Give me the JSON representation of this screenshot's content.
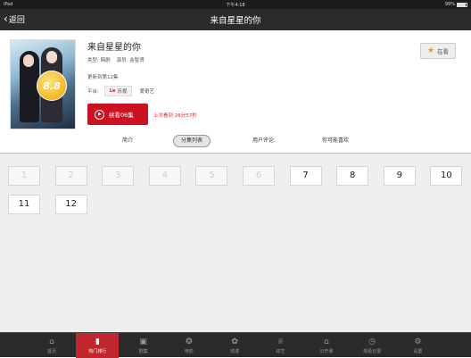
{
  "status_bar": {
    "device": "iPad",
    "time": "下午4:18",
    "battery": "99%"
  },
  "nav": {
    "back_label": "返回",
    "title": "来自星星的你"
  },
  "show": {
    "title": "来自星星的你",
    "genre_label": "类型:",
    "genre": "韩剧",
    "cast_label": "演员:",
    "cast": "金智贤",
    "update_status": "更新到第12集",
    "platform_label": "平台:",
    "platforms": [
      "乐视",
      "爱奇艺"
    ],
    "platform_letv_mark": "Le",
    "score": "8.8",
    "play_label": "续看06集",
    "last_watched": "上次看到 26分57秒",
    "watch_label": "在看"
  },
  "tabs": [
    "简介",
    "分集列表",
    "用户评论",
    "你可能喜欢"
  ],
  "active_tab": 1,
  "episodes": [
    {
      "num": "1",
      "available": false
    },
    {
      "num": "2",
      "available": false
    },
    {
      "num": "3",
      "available": false
    },
    {
      "num": "4",
      "available": false
    },
    {
      "num": "5",
      "available": false
    },
    {
      "num": "6",
      "available": false
    },
    {
      "num": "7",
      "available": true
    },
    {
      "num": "8",
      "available": true
    },
    {
      "num": "9",
      "available": true
    },
    {
      "num": "10",
      "available": true
    },
    {
      "num": "11",
      "available": true
    },
    {
      "num": "12",
      "available": true
    }
  ],
  "tabbar": [
    {
      "label": "首页",
      "icon": "home-icon",
      "glyph": "⌂"
    },
    {
      "label": "热门排行",
      "icon": "ranking-icon",
      "glyph": "▮",
      "active": true
    },
    {
      "label": "剧集",
      "icon": "tv-series-icon",
      "glyph": "▣"
    },
    {
      "label": "电影",
      "icon": "film-reel-icon",
      "glyph": "❂"
    },
    {
      "label": "动漫",
      "icon": "anime-icon",
      "glyph": "✿"
    },
    {
      "label": "综艺",
      "icon": "variety-icon",
      "glyph": "♕"
    },
    {
      "label": "公开课",
      "icon": "open-course-icon",
      "glyph": "⌂"
    },
    {
      "label": "观看记录",
      "icon": "history-clock-icon",
      "glyph": "◷"
    },
    {
      "label": "设置",
      "icon": "settings-gear-icon",
      "glyph": "⚙"
    }
  ],
  "colors": {
    "accent": "#c12228",
    "dark": "#2b2b2b",
    "star": "#f5a000"
  }
}
